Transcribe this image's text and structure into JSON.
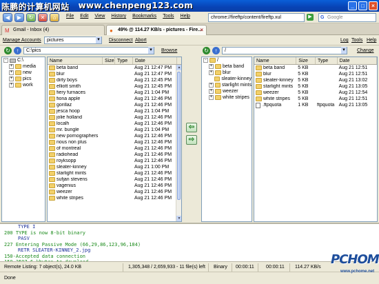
{
  "watermark": {
    "left": "陈鹏的计算机网站",
    "right": "www.chenpeng123.com"
  },
  "browser": {
    "menus": [
      "File",
      "Edit",
      "View",
      "History",
      "Bookmarks",
      "Tools",
      "Help"
    ],
    "url": "chrome://fireftp/content/fireftp.xul",
    "search_engine": "Google",
    "tabs": [
      {
        "label": "Gmail - Inbox (4)",
        "icon": "gmail-icon"
      },
      {
        "label": "49% @ 114.27 KB/s - pictures - Fire...",
        "icon": "fireftp-icon"
      }
    ]
  },
  "ftp_toolbar": {
    "manage_accounts": "Manage Accounts",
    "account": "pictures",
    "disconnect": "Disconnect",
    "abort": "Abort",
    "log": "Log",
    "tools": "Tools",
    "help": "Help"
  },
  "local": {
    "path": "C:\\pics",
    "browse": "Browse",
    "tree": [
      {
        "label": "C:\\",
        "level": 0,
        "toggle": "-",
        "icon": "drive"
      },
      {
        "label": "media",
        "level": 1,
        "toggle": "+",
        "icon": "folder"
      },
      {
        "label": "new",
        "level": 1,
        "toggle": "+",
        "icon": "folder"
      },
      {
        "label": "pics",
        "level": 1,
        "toggle": "+",
        "icon": "folder"
      },
      {
        "label": "work",
        "level": 1,
        "toggle": "+",
        "icon": "folder"
      }
    ],
    "columns": [
      "Name",
      "Size",
      "Type",
      "Date"
    ],
    "files": [
      {
        "name": "beta band",
        "date": "Aug 21 12:47 PM"
      },
      {
        "name": "blur",
        "date": "Aug 21 12:47 PM"
      },
      {
        "name": "dirty boys",
        "date": "Aug 21 12:45 PM"
      },
      {
        "name": "elliott smith",
        "date": "Aug 21 12:45 PM"
      },
      {
        "name": "fiery furnaces",
        "date": "Aug 21 1:04 PM"
      },
      {
        "name": "fiona apple",
        "date": "Aug 21 12:46 PM"
      },
      {
        "name": "gorillaz",
        "date": "Aug 21 12:46 PM"
      },
      {
        "name": "jesca hoop",
        "date": "Aug 21 1:04 PM"
      },
      {
        "name": "jolie holland",
        "date": "Aug 21 12:46 PM"
      },
      {
        "name": "localh",
        "date": "Aug 21 12:46 PM"
      },
      {
        "name": "mr. bungle",
        "date": "Aug 21 1:04 PM"
      },
      {
        "name": "new pornographers",
        "date": "Aug 21 12:46 PM"
      },
      {
        "name": "nous non plus",
        "date": "Aug 21 12:46 PM"
      },
      {
        "name": "of montreal",
        "date": "Aug 21 12:46 PM"
      },
      {
        "name": "radiohead",
        "date": "Aug 21 12:46 PM"
      },
      {
        "name": "royksopp",
        "date": "Aug 21 12:46 PM"
      },
      {
        "name": "sleater-kinney",
        "date": "Aug 21 1:00 PM"
      },
      {
        "name": "starlight mints",
        "date": "Aug 21 12:46 PM"
      },
      {
        "name": "sufjan stevens",
        "date": "Aug 21 12:46 PM"
      },
      {
        "name": "vagenius",
        "date": "Aug 21 12:46 PM"
      },
      {
        "name": "weezer",
        "date": "Aug 21 12:46 PM"
      },
      {
        "name": "white stripes",
        "date": "Aug 21 12:46 PM"
      }
    ]
  },
  "remote": {
    "path": "/",
    "change": "Change",
    "tree": [
      {
        "label": "/",
        "level": 0,
        "toggle": "-",
        "icon": "folder"
      },
      {
        "label": "beta band",
        "level": 1,
        "toggle": "+",
        "icon": "folder"
      },
      {
        "label": "blur",
        "level": 1,
        "toggle": "+",
        "icon": "folder"
      },
      {
        "label": "sleater-kinney",
        "level": 1,
        "toggle": "",
        "icon": "folder"
      },
      {
        "label": "starlight mints",
        "level": 1,
        "toggle": "+",
        "icon": "folder"
      },
      {
        "label": "weezer",
        "level": 1,
        "toggle": "+",
        "icon": "folder"
      },
      {
        "label": "white stripes",
        "level": 1,
        "toggle": "+",
        "icon": "folder"
      }
    ],
    "columns": [
      "Name",
      "Size",
      "Type",
      "Date"
    ],
    "files": [
      {
        "name": "beta band",
        "size": "5 KB",
        "type": "",
        "date": "Aug 21 12:51",
        "icon": "folder"
      },
      {
        "name": "blur",
        "size": "5 KB",
        "type": "",
        "date": "Aug 21 12:51",
        "icon": "folder"
      },
      {
        "name": "sleater-kinney",
        "size": "5 KB",
        "type": "",
        "date": "Aug 21 13:02",
        "icon": "folder"
      },
      {
        "name": "starlight mints",
        "size": "5 KB",
        "type": "",
        "date": "Aug 21 13:05",
        "icon": "folder"
      },
      {
        "name": "weezer",
        "size": "5 KB",
        "type": "",
        "date": "Aug 21 12:54",
        "icon": "folder"
      },
      {
        "name": "white stripes",
        "size": "5 KB",
        "type": "",
        "date": "Aug 21 12:51",
        "icon": "folder"
      },
      {
        "name": ".ftpquota",
        "size": "1 KB",
        "type": "ftpquota",
        "date": "Aug 21 13:05",
        "icon": "file"
      }
    ]
  },
  "log": [
    {
      "text": "TYPE I",
      "kind": "cmd"
    },
    {
      "text": "200 TYPE is now 8-bit binary",
      "kind": "resp"
    },
    {
      "text": "PASV",
      "kind": "cmd"
    },
    {
      "text": "227 Entering Passive Mode (66,29,86,123,96,184)",
      "kind": "resp"
    },
    {
      "text": "RETR SLEATER-KINNEY_2.jpg",
      "kind": "cmd"
    },
    {
      "text": "150-Accepted data connection",
      "kind": "resp"
    },
    {
      "text": "150 2597.6 kbytes to download",
      "kind": "resp"
    }
  ],
  "status": {
    "listing": "Remote Listing: 7 object(s), 24.0 KB",
    "progress": "1,305,348 / 2,659,933 - 11 file(s) left",
    "mode": "Binary",
    "elapsed": "00:00:11",
    "remaining": "00:00:11",
    "rate": "114.27 KB/s"
  },
  "statusbar": {
    "text": "Done"
  },
  "logo": {
    "brand": "PCHOME",
    "url": "www.pchome.net"
  }
}
